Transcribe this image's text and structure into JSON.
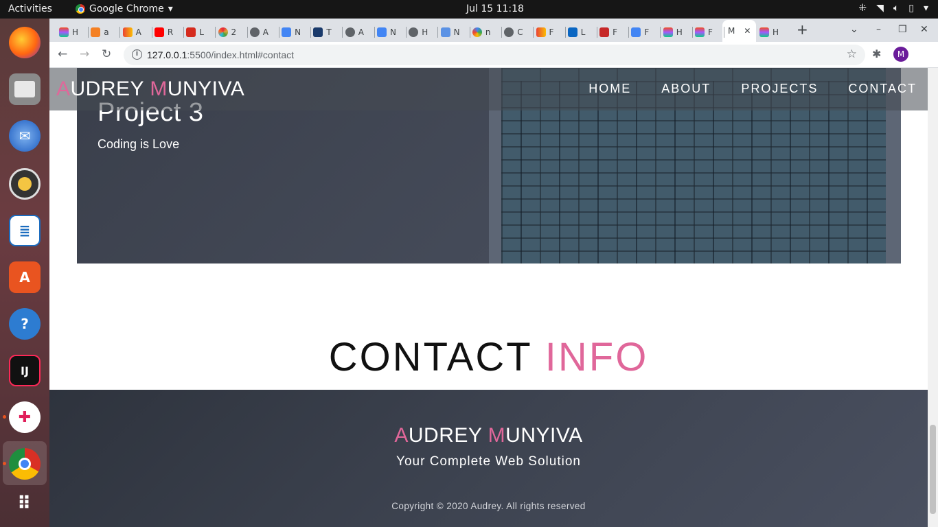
{
  "system": {
    "activities": "Activities",
    "app_name": "Google Chrome",
    "clock": "Jul 15  11:18",
    "tray_icons": [
      "network-icon",
      "wifi-icon",
      "volume-icon",
      "battery-icon",
      "power-menu-icon"
    ]
  },
  "dock": {
    "items": [
      "firefox",
      "files",
      "thunderbird",
      "rhythmbox",
      "libreoffice-impress",
      "software-center",
      "help",
      "intellij",
      "slack",
      "chrome",
      "app-grid"
    ]
  },
  "browser": {
    "tabs": [
      {
        "letter": "H",
        "icon": "figma-icon"
      },
      {
        "letter": "a",
        "icon": "stackoverflow-icon"
      },
      {
        "letter": "A",
        "icon": "gmail-icon"
      },
      {
        "letter": "R",
        "icon": "youtube-icon"
      },
      {
        "letter": "L",
        "icon": "swiss-icon"
      },
      {
        "letter": "2",
        "icon": "sdg-icon"
      },
      {
        "letter": "A",
        "icon": "globe-icon"
      },
      {
        "letter": "N",
        "icon": "docs-icon"
      },
      {
        "letter": "T",
        "icon": "s-icon"
      },
      {
        "letter": "A",
        "icon": "globe-icon"
      },
      {
        "letter": "N",
        "icon": "docs-icon"
      },
      {
        "letter": "H",
        "icon": "globe-icon"
      },
      {
        "letter": "N",
        "icon": "un-icon"
      },
      {
        "letter": "n",
        "icon": "google-icon"
      },
      {
        "letter": "C",
        "icon": "globe-icon"
      },
      {
        "letter": "F",
        "icon": "gmail-icon"
      },
      {
        "letter": "L",
        "icon": "linkedin-icon"
      },
      {
        "letter": "F",
        "icon": "j-icon"
      },
      {
        "letter": "F",
        "icon": "docs-icon"
      },
      {
        "letter": "H",
        "icon": "figma-icon"
      },
      {
        "letter": "F",
        "icon": "figma-icon"
      }
    ],
    "active_tab": {
      "letter": "M",
      "close": "✕"
    },
    "trailing_tab": {
      "letter": "H",
      "icon": "figma-icon"
    },
    "new_tab": "+",
    "url_host": "127.0.0.1",
    "url_rest": ":5500/index.html#contact",
    "profile_initial": "M"
  },
  "site": {
    "logo": {
      "a": "A",
      "udrey": "UDREY ",
      "m": "M",
      "unyiva": "UNYIVA"
    },
    "nav": [
      "HOME",
      "ABOUT",
      "PROJECTS",
      "CONTACT"
    ],
    "project": {
      "title": "Project 3",
      "description": "Coding is Love"
    },
    "contact": {
      "word1": "CONTACT ",
      "word2": "INFO"
    },
    "footer": {
      "tagline": "Your Complete Web Solution",
      "copyright": "Copyright © 2020 Audrey. All rights reserved"
    }
  },
  "colors": {
    "accent": "#e0679a",
    "footer_bg": "#3d4350"
  }
}
